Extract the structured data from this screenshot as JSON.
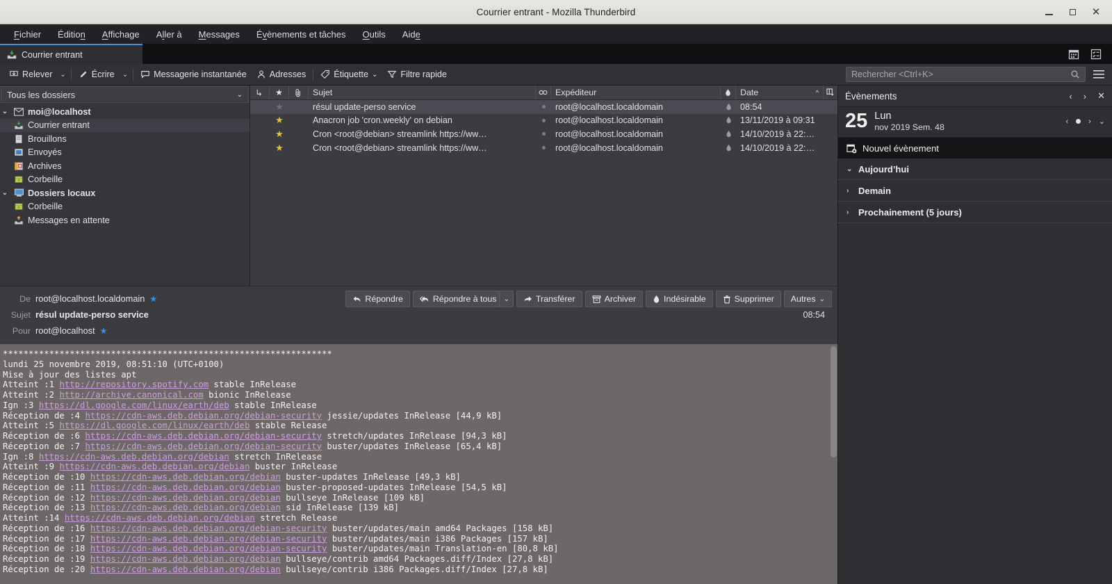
{
  "window": {
    "title": "Courrier entrant - Mozilla Thunderbird",
    "minimize_label": "Réduire",
    "maximize_label": "Agrandir",
    "close_label": "Fermer"
  },
  "menubar": [
    {
      "label": "Fichier",
      "accel": "F"
    },
    {
      "label": "Édition",
      "accel": "n"
    },
    {
      "label": "Affichage",
      "accel": "A"
    },
    {
      "label": "Aller à",
      "accel": "l"
    },
    {
      "label": "Messages",
      "accel": "M"
    },
    {
      "label": "Évènements et tâches",
      "accel": "v"
    },
    {
      "label": "Outils",
      "accel": "O"
    },
    {
      "label": "Aide",
      "accel": "e"
    }
  ],
  "tabbar": {
    "tabs": [
      {
        "label": "Courrier entrant",
        "icon": "inbox-icon",
        "active": true
      }
    ],
    "right_icons": [
      {
        "name": "calendar-tab-icon"
      },
      {
        "name": "tasks-tab-icon"
      }
    ]
  },
  "toolbar": {
    "get_messages": "Relever",
    "write": "Écrire",
    "chat": "Messagerie instantanée",
    "address_book": "Adresses",
    "tag": "Étiquette",
    "quick_filter": "Filtre rapide",
    "search_placeholder": "Rechercher <Ctrl+K>",
    "app_menu": "Menu de l'application"
  },
  "folderpane": {
    "selector_label": "Tous les dossiers",
    "items": [
      {
        "label": "moi@localhost",
        "icon": "account-mail-icon",
        "indent": 0,
        "bold": true,
        "selected": false,
        "twisty": "v"
      },
      {
        "label": "Courrier entrant",
        "icon": "inbox-icon",
        "indent": 1,
        "bold": false,
        "selected": true,
        "twisty": ""
      },
      {
        "label": "Brouillons",
        "icon": "drafts-icon",
        "indent": 1,
        "bold": false,
        "selected": false,
        "twisty": ""
      },
      {
        "label": "Envoyés",
        "icon": "sent-icon",
        "indent": 1,
        "bold": false,
        "selected": false,
        "twisty": ""
      },
      {
        "label": "Archives",
        "icon": "archive-icon",
        "indent": 1,
        "bold": false,
        "selected": false,
        "twisty": ""
      },
      {
        "label": "Corbeille",
        "icon": "trash-icon",
        "indent": 1,
        "bold": false,
        "selected": false,
        "twisty": ""
      },
      {
        "label": "Dossiers locaux",
        "icon": "local-folders-icon",
        "indent": 0,
        "bold": true,
        "selected": false,
        "twisty": "v"
      },
      {
        "label": "Corbeille",
        "icon": "trash-icon",
        "indent": 1,
        "bold": false,
        "selected": false,
        "twisty": ""
      },
      {
        "label": "Messages en attente",
        "icon": "outbox-icon",
        "indent": 1,
        "bold": false,
        "selected": false,
        "twisty": ""
      }
    ]
  },
  "messagelist": {
    "columns": {
      "thread": "thread-column-icon",
      "star": "star-column-icon",
      "attachment": "attachment-column-icon",
      "subject": "Sujet",
      "smiley": "smiley-column-icon",
      "sender": "Expéditeur",
      "junk": "junk-column-icon",
      "date": "Date",
      "sort_arrow": "^",
      "column_picker": "column-picker-icon"
    },
    "rows": [
      {
        "subject": "résul update-perso service",
        "sender": "root@localhost.localdomain",
        "date": "08:54",
        "starred": false,
        "selected": true
      },
      {
        "subject": "Anacron job 'cron.weekly' on debian",
        "sender": "root@localhost.localdomain",
        "date": "13/11/2019 à 09:31",
        "starred": true,
        "selected": false
      },
      {
        "subject": "Cron <root@debian> streamlink https://ww…",
        "sender": "root@localhost.localdomain",
        "date": "14/10/2019 à 22:…",
        "starred": true,
        "selected": false
      },
      {
        "subject": "Cron <root@debian> streamlink https://ww…",
        "sender": "root@localhost.localdomain",
        "date": "14/10/2019 à 22:…",
        "starred": true,
        "selected": false
      }
    ]
  },
  "message": {
    "from_label": "De",
    "from_value": "root@localhost.localdomain",
    "subject_label": "Sujet",
    "subject_value": "résul update-perso service",
    "to_label": "Pour",
    "to_value": "root@localhost",
    "time": "08:54",
    "actions": {
      "reply": "Répondre",
      "reply_all": "Répondre à tous",
      "forward": "Transférer",
      "archive": "Archiver",
      "junk": "Indésirable",
      "delete": "Supprimer",
      "more": "Autres"
    },
    "body_lines": [
      {
        "segments": [
          {
            "t": "****************************************************************"
          }
        ]
      },
      {
        "segments": [
          {
            "t": "lundi 25 novembre 2019, 08:51:10 (UTC+0100)"
          }
        ]
      },
      {
        "segments": [
          {
            "t": "Mise à jour des listes apt"
          }
        ]
      },
      {
        "segments": [
          {
            "t": "Atteint :1 "
          },
          {
            "t": "http://repository.spotify.com",
            "link": true
          },
          {
            "t": " stable InRelease"
          }
        ]
      },
      {
        "segments": [
          {
            "t": "Atteint :2 "
          },
          {
            "t": "http://archive.canonical.com",
            "link": true
          },
          {
            "t": " bionic InRelease"
          }
        ]
      },
      {
        "segments": [
          {
            "t": "Ign :3 "
          },
          {
            "t": "https://dl.google.com/linux/earth/deb",
            "link": true
          },
          {
            "t": " stable InRelease"
          }
        ]
      },
      {
        "segments": [
          {
            "t": "Réception de :4 "
          },
          {
            "t": "https://cdn-aws.deb.debian.org/debian-security",
            "link": true
          },
          {
            "t": " jessie/updates InRelease [44,9 kB]"
          }
        ]
      },
      {
        "segments": [
          {
            "t": "Atteint :5 "
          },
          {
            "t": "https://dl.google.com/linux/earth/deb",
            "link": true
          },
          {
            "t": " stable Release"
          }
        ]
      },
      {
        "segments": [
          {
            "t": "Réception de :6 "
          },
          {
            "t": "https://cdn-aws.deb.debian.org/debian-security",
            "link": true
          },
          {
            "t": " stretch/updates InRelease [94,3 kB]"
          }
        ]
      },
      {
        "segments": [
          {
            "t": "Réception de :7 "
          },
          {
            "t": "https://cdn-aws.deb.debian.org/debian-security",
            "link": true
          },
          {
            "t": " buster/updates InRelease [65,4 kB]"
          }
        ]
      },
      {
        "segments": [
          {
            "t": "Ign :8 "
          },
          {
            "t": "https://cdn-aws.deb.debian.org/debian",
            "link": true
          },
          {
            "t": " stretch InRelease"
          }
        ]
      },
      {
        "segments": [
          {
            "t": "Atteint :9 "
          },
          {
            "t": "https://cdn-aws.deb.debian.org/debian",
            "link": true
          },
          {
            "t": " buster InRelease"
          }
        ]
      },
      {
        "segments": [
          {
            "t": "Réception de :10 "
          },
          {
            "t": "https://cdn-aws.deb.debian.org/debian",
            "link": true
          },
          {
            "t": " buster-updates InRelease [49,3 kB]"
          }
        ]
      },
      {
        "segments": [
          {
            "t": "Réception de :11 "
          },
          {
            "t": "https://cdn-aws.deb.debian.org/debian",
            "link": true
          },
          {
            "t": " buster-proposed-updates InRelease [54,5 kB]"
          }
        ]
      },
      {
        "segments": [
          {
            "t": "Réception de :12 "
          },
          {
            "t": "https://cdn-aws.deb.debian.org/debian",
            "link": true
          },
          {
            "t": " bullseye InRelease [109 kB]"
          }
        ]
      },
      {
        "segments": [
          {
            "t": "Réception de :13 "
          },
          {
            "t": "https://cdn-aws.deb.debian.org/debian",
            "link": true
          },
          {
            "t": " sid InRelease [139 kB]"
          }
        ]
      },
      {
        "segments": [
          {
            "t": "Atteint :14 "
          },
          {
            "t": "https://cdn-aws.deb.debian.org/debian",
            "link": true
          },
          {
            "t": " stretch Release"
          }
        ]
      },
      {
        "segments": [
          {
            "t": "Réception de :16 "
          },
          {
            "t": "https://cdn-aws.deb.debian.org/debian-security",
            "link": true
          },
          {
            "t": " buster/updates/main amd64 Packages [158 kB]"
          }
        ]
      },
      {
        "segments": [
          {
            "t": "Réception de :17 "
          },
          {
            "t": "https://cdn-aws.deb.debian.org/debian-security",
            "link": true
          },
          {
            "t": " buster/updates/main i386 Packages [157 kB]"
          }
        ]
      },
      {
        "segments": [
          {
            "t": "Réception de :18 "
          },
          {
            "t": "https://cdn-aws.deb.debian.org/debian-security",
            "link": true
          },
          {
            "t": " buster/updates/main Translation-en [80,8 kB]"
          }
        ]
      },
      {
        "segments": [
          {
            "t": "Réception de :19 "
          },
          {
            "t": "https://cdn-aws.deb.debian.org/debian",
            "link": true
          },
          {
            "t": " bullseye/contrib amd64 Packages.diff/Index [27,8 kB]"
          }
        ]
      },
      {
        "segments": [
          {
            "t": "Réception de :20 "
          },
          {
            "t": "https://cdn-aws.deb.debian.org/debian",
            "link": true
          },
          {
            "t": " bullseye/contrib i386 Packages.diff/Index [27,8 kB]"
          }
        ]
      }
    ]
  },
  "events": {
    "title": "Évènements",
    "prev_label": "‹",
    "next_label": "›",
    "close_label": "✕",
    "day_number": "25",
    "day_of_week": "Lun",
    "month_year_week": "nov 2019  Sem. 48",
    "new_event": "Nouvel évènement",
    "sections": [
      {
        "label": "Aujourd’hui",
        "expanded": true
      },
      {
        "label": "Demain",
        "expanded": false
      },
      {
        "label": "Prochainement (5 jours)",
        "expanded": false
      }
    ]
  }
}
